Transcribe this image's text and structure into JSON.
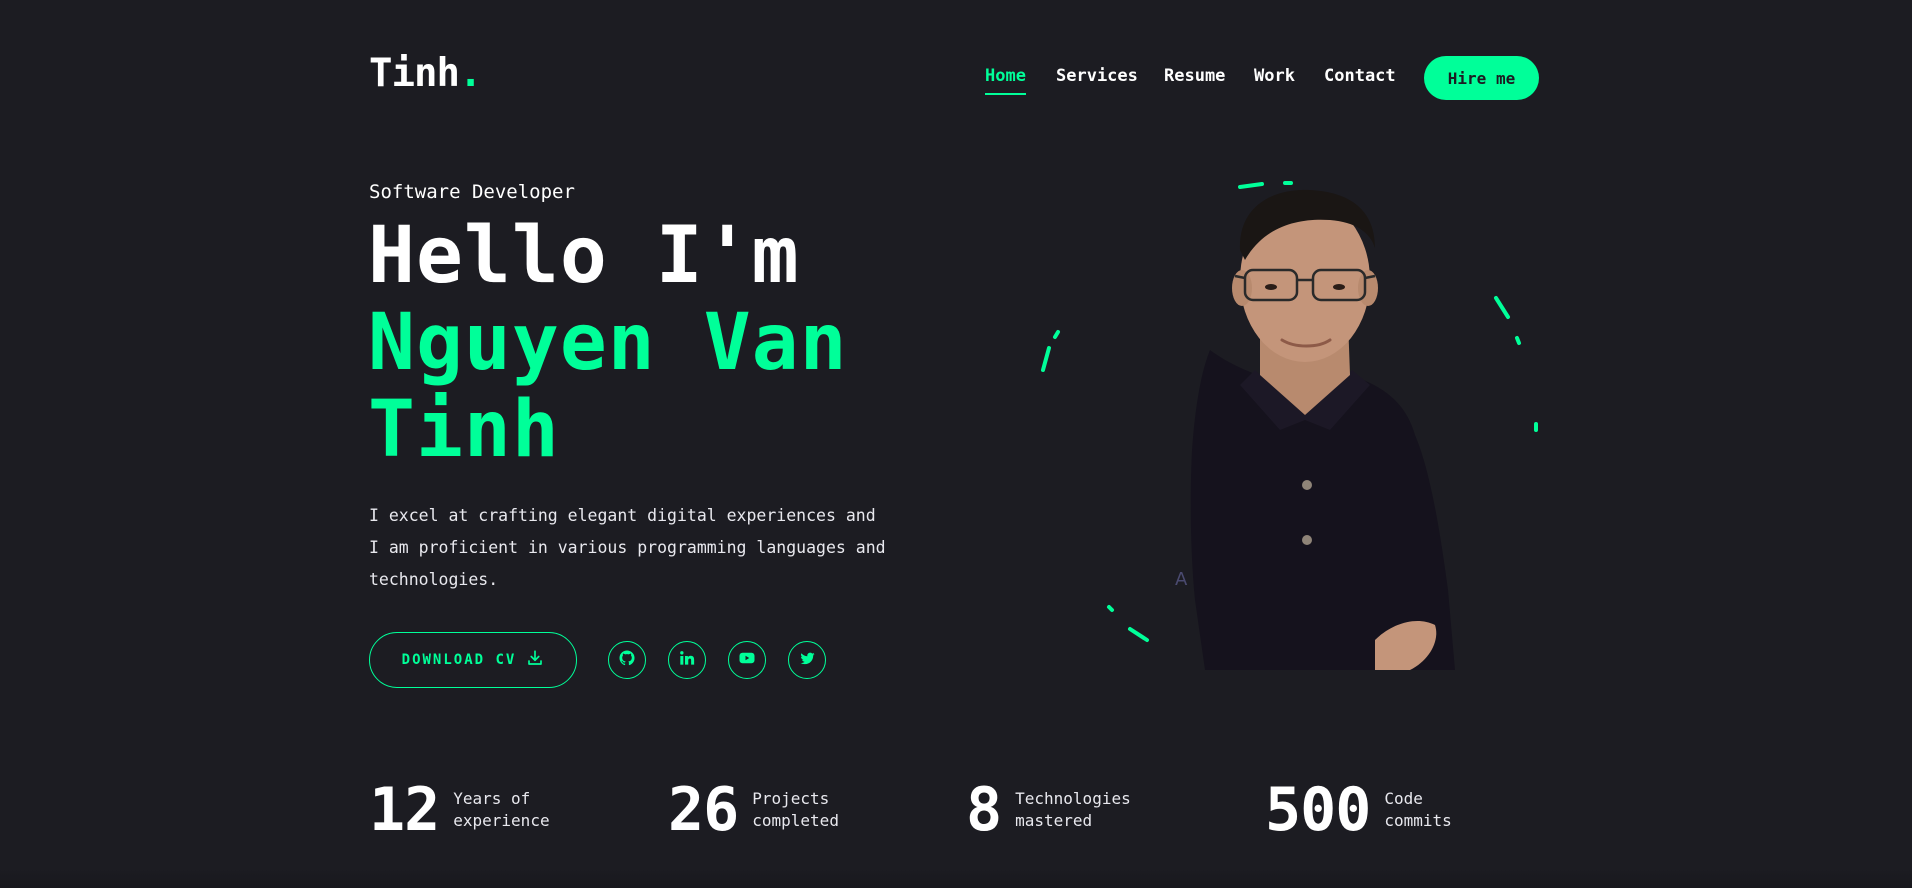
{
  "header": {
    "logo_text": "Tinh",
    "logo_dot": ".",
    "nav": [
      {
        "label": "Home",
        "active": true
      },
      {
        "label": "Services",
        "active": false
      },
      {
        "label": "Resume",
        "active": false
      },
      {
        "label": "Work",
        "active": false
      },
      {
        "label": "Contact",
        "active": false
      }
    ],
    "hire_label": "Hire me"
  },
  "hero": {
    "subtitle": "Software Developer",
    "greeting": "Hello I'm",
    "name_line1": "Nguyen Van",
    "name_line2": "Tinh",
    "description": "I excel at crafting elegant digital experiences and I am proficient in various programming languages and technologies.",
    "cv_label": "DOWNLOAD CV",
    "socials": [
      {
        "icon": "github-icon"
      },
      {
        "icon": "linkedin-icon"
      },
      {
        "icon": "youtube-icon"
      },
      {
        "icon": "twitter-icon"
      }
    ]
  },
  "stats": [
    {
      "value": "12",
      "label_line1": "Years of",
      "label_line2": "experience"
    },
    {
      "value": "26",
      "label_line1": "Projects",
      "label_line2": "completed"
    },
    {
      "value": "8",
      "label_line1": "Technologies",
      "label_line2": "mastered"
    },
    {
      "value": "500",
      "label_line1": "Code",
      "label_line2": "commits"
    }
  ],
  "colors": {
    "accent": "#00ff99",
    "background": "#1c1c22"
  }
}
